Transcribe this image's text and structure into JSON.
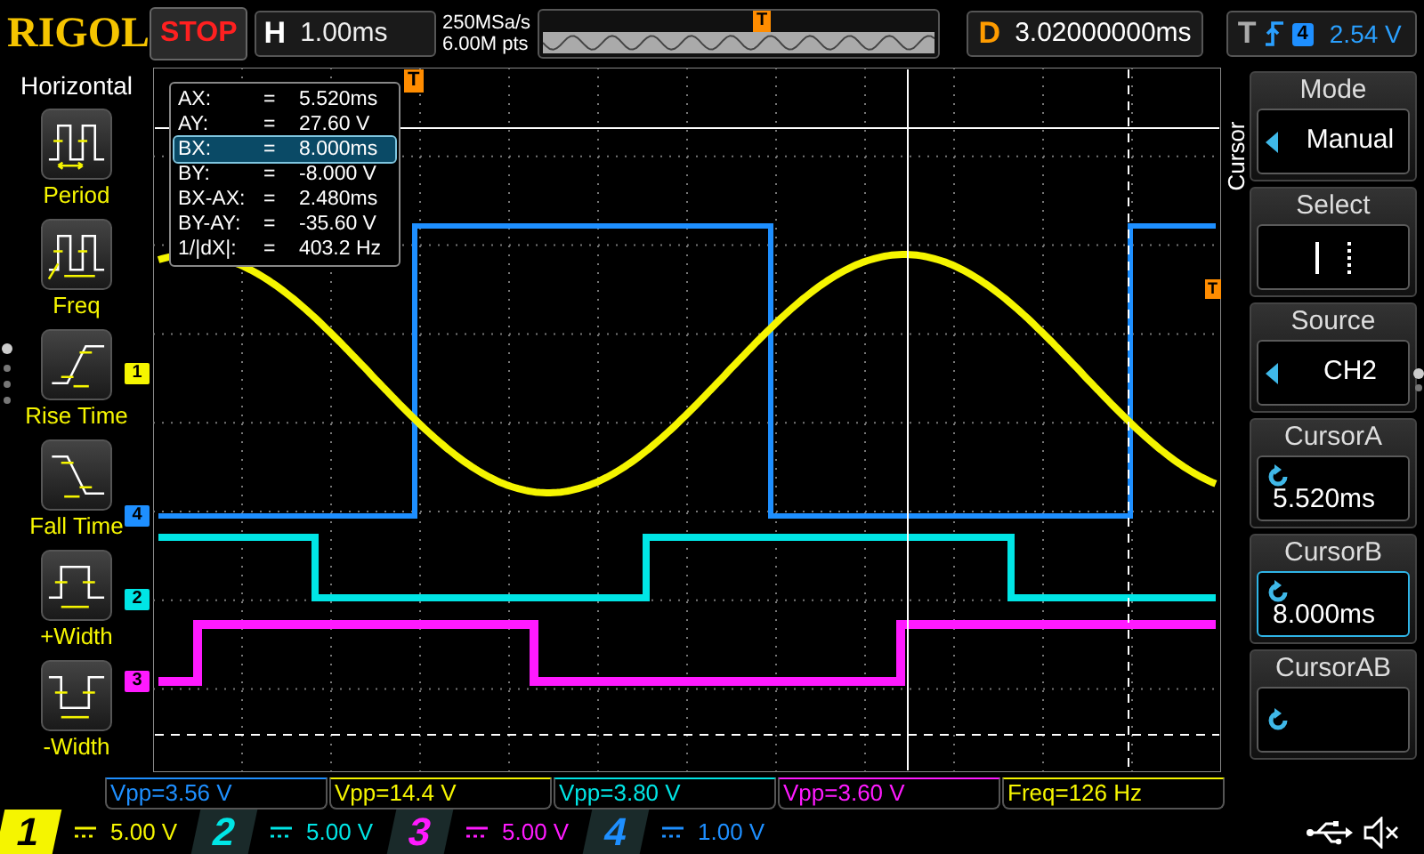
{
  "brand": "RIGOL",
  "run_state": "STOP",
  "horizontal": {
    "label": "H",
    "value": "1.00ms"
  },
  "acquisition": {
    "sample_rate": "250MSa/s",
    "memory_depth": "6.00M pts"
  },
  "overview": {
    "marker": "T"
  },
  "delay": {
    "label": "D",
    "value": "3.02000000ms"
  },
  "trigger": {
    "label": "T",
    "source": "4",
    "level": "2.54 V"
  },
  "measure_menu": {
    "title": "Horizontal",
    "items": [
      {
        "label": "Period",
        "kind": "period"
      },
      {
        "label": "Freq",
        "kind": "freq"
      },
      {
        "label": "Rise Time",
        "kind": "rise"
      },
      {
        "label": "Fall Time",
        "kind": "fall"
      },
      {
        "label": "+Width",
        "kind": "pwidth"
      },
      {
        "label": "-Width",
        "kind": "nwidth"
      }
    ]
  },
  "display": {
    "trigger_position_marker": "T",
    "trigger_level_marker": "T",
    "channel_markers": [
      {
        "label": "1",
        "color": "#f5f500"
      },
      {
        "label": "4",
        "color": "#1e8fff"
      },
      {
        "label": "2",
        "color": "#00e5e5"
      },
      {
        "label": "3",
        "color": "#ff1aff"
      }
    ],
    "cursor_readout": [
      {
        "label": "AX:",
        "sep": "=",
        "value": "5.520ms",
        "selected": false
      },
      {
        "label": "AY:",
        "sep": "=",
        "value": "27.60 V",
        "selected": false
      },
      {
        "label": "BX:",
        "sep": "=",
        "value": "8.000ms",
        "selected": true
      },
      {
        "label": "BY:",
        "sep": "=",
        "value": "-8.000 V",
        "selected": false
      },
      {
        "label": "BX-AX:",
        "sep": "=",
        "value": "2.480ms",
        "selected": false
      },
      {
        "label": "BY-AY:",
        "sep": "=",
        "value": "-35.60 V",
        "selected": false
      },
      {
        "label": "1/|dX|:",
        "sep": "=",
        "value": "403.2 Hz",
        "selected": false
      }
    ]
  },
  "softkey_menu": {
    "title": "Cursor",
    "items": [
      {
        "label": "Mode",
        "kind": "choice",
        "value": "Manual",
        "selected": false
      },
      {
        "label": "Select",
        "kind": "select",
        "selected": false
      },
      {
        "label": "Source",
        "kind": "choice",
        "value": "CH2",
        "selected": false
      },
      {
        "label": "CursorA",
        "kind": "knob",
        "value": "5.520ms",
        "selected": false
      },
      {
        "label": "CursorB",
        "kind": "knob",
        "value": "8.000ms",
        "selected": true
      },
      {
        "label": "CursorAB",
        "kind": "knob",
        "selected": false
      }
    ]
  },
  "measurements": [
    {
      "text": "Vpp=3.56 V",
      "color": "#1e8fff"
    },
    {
      "text": "Vpp=14.4 V",
      "color": "#f5f500"
    },
    {
      "text": "Vpp=3.80 V",
      "color": "#00e5e5"
    },
    {
      "text": "Vpp=3.60 V",
      "color": "#ff1aff"
    },
    {
      "text": "Freq=126 Hz",
      "color": "#f5f500"
    }
  ],
  "channels": [
    {
      "number": "1",
      "scale": "5.00 V",
      "color": "#f5f500",
      "selected": true
    },
    {
      "number": "2",
      "scale": "5.00 V",
      "color": "#00e5e5",
      "selected": false
    },
    {
      "number": "3",
      "scale": "5.00 V",
      "color": "#ff1aff",
      "selected": false
    },
    {
      "number": "4",
      "scale": "1.00 V",
      "color": "#1e8fff",
      "selected": false
    }
  ]
}
